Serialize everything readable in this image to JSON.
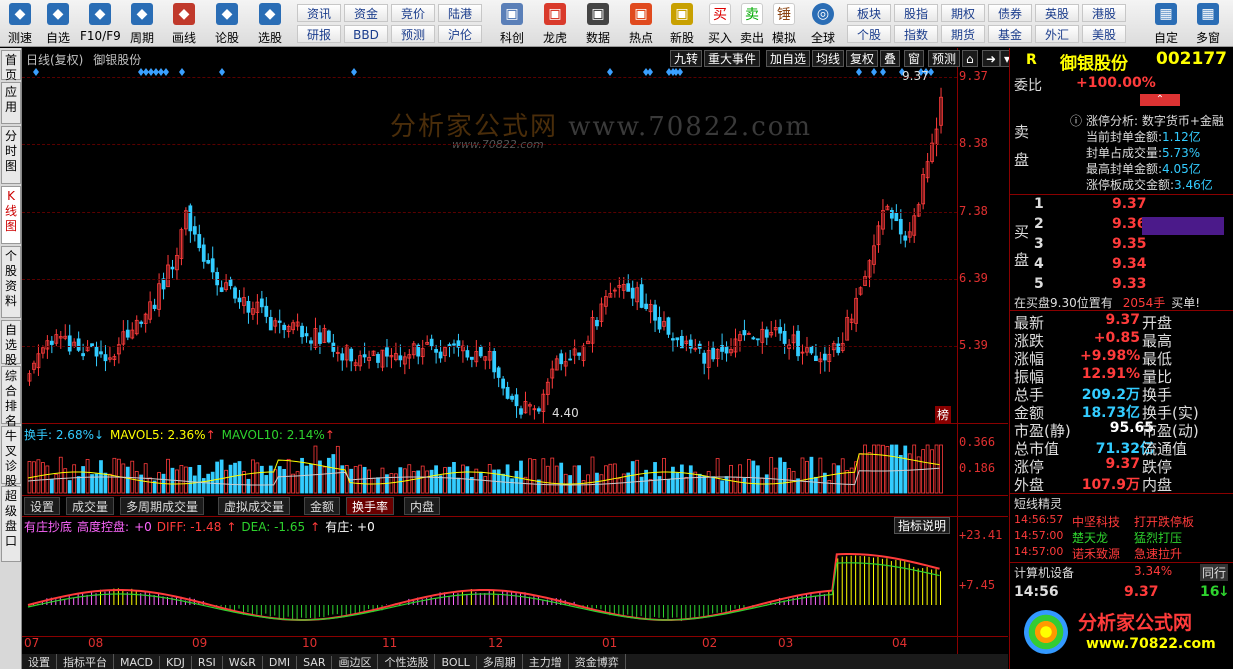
{
  "toolbar": {
    "left_buttons": [
      {
        "label": "测速",
        "icon": "clock-gauge-icon"
      },
      {
        "label": "自选",
        "icon": "star-icon"
      },
      {
        "label": "F10/F9",
        "icon": "document-icon"
      },
      {
        "label": "周期",
        "icon": "cycle-icon"
      },
      {
        "label": "画线",
        "icon": "pencil-icon"
      },
      {
        "label": "论股",
        "icon": "chat-icon"
      },
      {
        "label": "选股",
        "icon": "search-chart-icon"
      }
    ],
    "grid_buttons": [
      [
        "资讯",
        "资金",
        "竞价",
        "陆港"
      ],
      [
        "研报",
        "BBD",
        "预测",
        "沪伦"
      ]
    ],
    "mid_buttons": [
      {
        "label": "科创",
        "icon": "chart-icon"
      },
      {
        "label": "龙虎",
        "icon": "tiger-icon"
      },
      {
        "label": "数据",
        "icon": "pe-icon"
      },
      {
        "label": "热点",
        "icon": "fire-icon"
      },
      {
        "label": "新股",
        "icon": "ipo-icon"
      }
    ],
    "trade_buttons": [
      {
        "label": "买入",
        "glyph": "买"
      },
      {
        "label": "卖出",
        "glyph": "卖"
      },
      {
        "label": "模拟",
        "glyph": "锤"
      }
    ],
    "globe_label": "全球",
    "right_grid": [
      [
        "板块",
        "股指",
        "期权",
        "债券",
        "英股",
        "港股"
      ],
      [
        "个股",
        "指数",
        "期货",
        "基金",
        "外汇",
        "美股"
      ]
    ],
    "end_buttons": [
      {
        "label": "自定"
      },
      {
        "label": "多窗"
      }
    ]
  },
  "left_tabs": [
    "首页",
    "应用",
    "分时图",
    "K线图",
    "个股资料",
    "自选股",
    "综合排名",
    "牛叉诊股",
    "超级盘口"
  ],
  "left_tabs_active": 3,
  "chart_header": {
    "title": "日线(复权)",
    "stock": "御银股份"
  },
  "chart_buttons": [
    "九转",
    "重大事件",
    "加自选",
    "均线",
    "复权",
    "叠",
    "窗",
    "预测"
  ],
  "watermark": {
    "logo": "分析家公式网",
    "site": "www.70822.com",
    "small": "www.70822.com"
  },
  "price_axis": [
    "9.37",
    "8.38",
    "7.38",
    "6.39",
    "5.39"
  ],
  "annotations": {
    "high": "9.37",
    "low": "4.40",
    "tag": "榜"
  },
  "volume_panel": {
    "label1": "换手: 2.68%",
    "arrow1": "↓",
    "label2": "MAVOL5: 2.36%",
    "arrow2": "↑",
    "label3": "MAVOL10: 2.14%",
    "arrow3": "↑",
    "axis": [
      "0.366",
      "0.186"
    ]
  },
  "sub_tabs": [
    "设置",
    "成交量",
    "多周期成交量",
    "虚拟成交量",
    "金额",
    "换手率",
    "内盘"
  ],
  "sub_tab_active": 5,
  "macd_panel": {
    "label1": "有庄抄底",
    "label2": "高度控盘:",
    "v1": "+0",
    "diff": "DIFF: -1.48",
    "diff_arrow": "↑",
    "dea": "DEA: -1.65",
    "dea_arrow": "↑",
    "zhuang": "有庄: +0",
    "help": "指标说明",
    "axis": [
      "+23.41",
      "+7.45"
    ]
  },
  "date_axis": [
    "07",
    "08",
    "09",
    "10",
    "11",
    "12",
    "01",
    "02",
    "03",
    "04"
  ],
  "right_panel": {
    "r_label": "R",
    "stock_name": "御银股份",
    "stock_code": "002177",
    "weibi_label": "委比",
    "weibi_value": "+100.00%",
    "sell_label": "卖盘",
    "limit_title": "涨停分析: 数字货币+金融",
    "limit_rows": [
      {
        "k": "当前封单金额:",
        "v": "1.12亿"
      },
      {
        "k": "封单占成交量:",
        "v": "5.73%"
      },
      {
        "k": "最高封单金额:",
        "v": "4.05亿"
      },
      {
        "k": "涨停板成交金额:",
        "v": "3.46亿"
      }
    ],
    "buy_label": "买盘",
    "bids": [
      {
        "n": "1",
        "p": "9.37"
      },
      {
        "n": "2",
        "p": "9.36"
      },
      {
        "n": "3",
        "p": "9.35"
      },
      {
        "n": "4",
        "p": "9.34"
      },
      {
        "n": "5",
        "p": "9.33"
      }
    ],
    "notice_prefix": "在买盘9.30位置有",
    "notice_qty": "2054手",
    "notice_suffix": "买单!",
    "stats_left": [
      {
        "k": "最新",
        "v": "9.37",
        "c": "red"
      },
      {
        "k": "涨跌",
        "v": "+0.85",
        "c": "red"
      },
      {
        "k": "涨幅",
        "v": "+9.98%",
        "c": "red"
      },
      {
        "k": "振幅",
        "v": "12.91%",
        "c": "red"
      },
      {
        "k": "总手",
        "v": "209.2万",
        "c": "cyan"
      },
      {
        "k": "金额",
        "v": "18.73亿",
        "c": "cyan"
      },
      {
        "k": "市盈(静)",
        "v": "95.65",
        "c": "white"
      },
      {
        "k": "总市值",
        "v": "71.32亿",
        "c": "cyan"
      },
      {
        "k": "涨停",
        "v": "9.37",
        "c": "red"
      },
      {
        "k": "外盘",
        "v": "107.9万",
        "c": "red"
      }
    ],
    "stats_right": [
      "开盘",
      "最高",
      "最低",
      "量比",
      "换手",
      "换手(实)",
      "市盈(动)",
      "流通值",
      "跌停",
      "内盘"
    ],
    "sprite_title": "短线精灵",
    "sprites": [
      {
        "t": "14:56:57",
        "n": "中坚科技",
        "e": "打开跌停板",
        "nc": "red",
        "ec": "red"
      },
      {
        "t": "14:57:00",
        "n": "楚天龙",
        "e": "猛烈打压",
        "nc": "grn",
        "ec": "grn"
      },
      {
        "t": "14:57:00",
        "n": "诺禾致源",
        "e": "急速拉升",
        "nc": "red",
        "ec": "red"
      }
    ],
    "sector_name": "计算机设备",
    "sector_pct": "3.34%",
    "sector_tag": "同行",
    "tick_time": "14:56",
    "tick_price": "9.37",
    "tick_vol": "16",
    "tick_arrow": "↓",
    "logo_text": "分析家公式网",
    "logo_url": "www.70822.com"
  },
  "bottom_tabs": [
    "设置",
    "指标平台",
    "MACD",
    "KDJ",
    "RSI",
    "W&R",
    "DMI",
    "SAR",
    "画边区",
    "个性选股",
    "BOLL",
    "多周期",
    "主力增",
    "资金博弈"
  ]
}
